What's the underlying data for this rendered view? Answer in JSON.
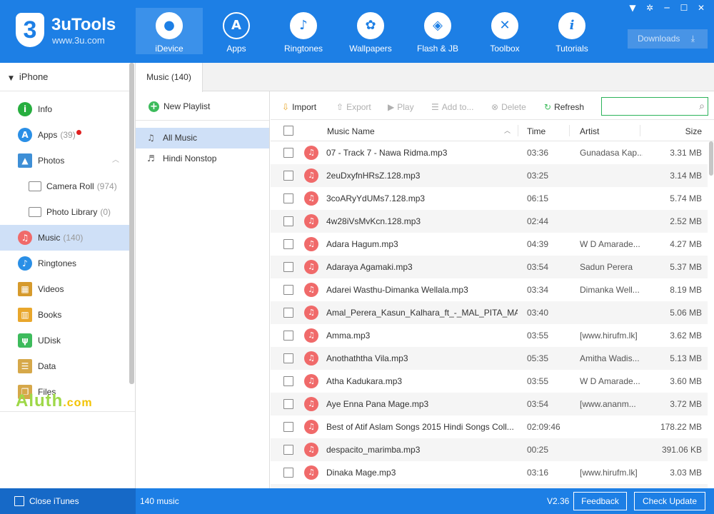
{
  "app": {
    "name": "3uTools",
    "url": "www.3u.com",
    "logo_mark": "3"
  },
  "nav": [
    {
      "label": "iDevice",
      "icon": "apple-icon",
      "glyph": "",
      "active": true
    },
    {
      "label": "Apps",
      "icon": "app-store-icon",
      "glyph": "A"
    },
    {
      "label": "Ringtones",
      "icon": "bell-icon",
      "glyph": "♪"
    },
    {
      "label": "Wallpapers",
      "icon": "flower-icon",
      "glyph": "✿"
    },
    {
      "label": "Flash & JB",
      "icon": "box-icon",
      "glyph": "◈"
    },
    {
      "label": "Toolbox",
      "icon": "tools-icon",
      "glyph": "✕"
    },
    {
      "label": "Tutorials",
      "icon": "info-icon",
      "glyph": "i"
    }
  ],
  "window_controls": [
    "shirt-icon",
    "gear-icon",
    "minimize-icon",
    "maximize-icon",
    "close-icon"
  ],
  "downloads": {
    "label": "Downloads",
    "icon": "download-icon"
  },
  "sidebar": {
    "device": "iPhone",
    "items": [
      {
        "label": "Info",
        "icon": "info-icon",
        "glyph": "i",
        "color": "#27ae3f"
      },
      {
        "label": "Apps",
        "count": "(39)",
        "icon": "app-store-icon",
        "glyph": "A",
        "color": "#2a8fe6",
        "badge_color": "#e02020"
      },
      {
        "label": "Photos",
        "icon": "photos-icon",
        "glyph": "▲",
        "color": "#3e8fd6"
      },
      {
        "label": "Camera Roll",
        "count": "(974)",
        "icon": "folder-icon",
        "sub": true
      },
      {
        "label": "Photo Library",
        "count": "(0)",
        "icon": "folder-icon",
        "sub": true
      },
      {
        "label": "Music",
        "count": "(140)",
        "icon": "music-icon",
        "glyph": "♫",
        "color": "#f06a6a",
        "selected": true
      },
      {
        "label": "Ringtones",
        "icon": "bell-icon",
        "glyph": "♪",
        "color": "#2a8fe6"
      },
      {
        "label": "Videos",
        "icon": "film-icon",
        "glyph": "▦",
        "color": "#d69a2c"
      },
      {
        "label": "Books",
        "icon": "book-icon",
        "glyph": "▥",
        "color": "#e9a72c"
      },
      {
        "label": "UDisk",
        "icon": "usb-icon",
        "glyph": "ψ",
        "color": "#3dbb5c"
      },
      {
        "label": "Data",
        "icon": "data-icon",
        "glyph": "☰",
        "color": "#d6a84a"
      },
      {
        "label": "Files",
        "icon": "files-icon",
        "glyph": "❐",
        "color": "#d6a84a"
      }
    ]
  },
  "watermark": {
    "main": "Aluth",
    "suffix": ".com"
  },
  "tab": {
    "label": "Music (140)"
  },
  "playlists": {
    "new_label": "New Playlist",
    "items": [
      {
        "label": "All Music",
        "icon": "music-list-icon",
        "selected": true
      },
      {
        "label": "Hindi Nonstop",
        "icon": "playlist-icon"
      }
    ]
  },
  "toolbar": {
    "import": "Import",
    "export": "Export",
    "play": "Play",
    "add_to": "Add to...",
    "delete": "Delete",
    "refresh": "Refresh",
    "search_placeholder": ""
  },
  "columns": {
    "name": "Music Name",
    "time": "Time",
    "artist": "Artist",
    "size": "Size"
  },
  "rows": [
    {
      "name": "07 - Track  7 - Nawa Ridma.mp3",
      "time": "03:36",
      "artist": "Gunadasa Kap...",
      "size": "3.31 MB"
    },
    {
      "name": "2euDxyfnHRsZ.128.mp3",
      "time": "03:25",
      "artist": "",
      "size": "3.14 MB"
    },
    {
      "name": "3coARyYdUMs7.128.mp3",
      "time": "06:15",
      "artist": "",
      "size": "5.74 MB"
    },
    {
      "name": "4w28iVsMvKcn.128.mp3",
      "time": "02:44",
      "artist": "",
      "size": "2.52 MB"
    },
    {
      "name": "Adara Hagum.mp3",
      "time": "04:39",
      "artist": "W D Amarade...",
      "size": "4.27 MB"
    },
    {
      "name": "Adaraya Agamaki.mp3",
      "time": "03:54",
      "artist": "Sadun Perera",
      "size": "5.37 MB"
    },
    {
      "name": "Adarei Wasthu-Dimanka Wellala.mp3",
      "time": "03:34",
      "artist": "Dimanka Well...",
      "size": "8.19 MB"
    },
    {
      "name": "Amal_Perera_Kasun_Kalhara_ft_-_MAL_PITA_MA...",
      "time": "03:40",
      "artist": "",
      "size": "5.06 MB"
    },
    {
      "name": "Amma.mp3",
      "time": "03:55",
      "artist": "[www.hirufm.lk]",
      "size": "3.62 MB"
    },
    {
      "name": "Anothaththa Vila.mp3",
      "time": "05:35",
      "artist": "Amitha Wadis...",
      "size": "5.13 MB"
    },
    {
      "name": "Atha Kadukara.mp3",
      "time": "03:55",
      "artist": "W D Amarade...",
      "size": "3.60 MB"
    },
    {
      "name": "Aye Enna Pana Mage.mp3",
      "time": "03:54",
      "artist": "[www.ananm...",
      "size": "3.72 MB"
    },
    {
      "name": "Best of Atif Aslam Songs 2015   Hindi Songs Coll...",
      "time": "02:09:46",
      "artist": "",
      "size": "178.22 MB"
    },
    {
      "name": "despacito_marimba.mp3",
      "time": "00:25",
      "artist": "",
      "size": "391.06 KB"
    },
    {
      "name": "Dinaka Mage.mp3",
      "time": "03:16",
      "artist": "[www.hirufm.lk]",
      "size": "3.03 MB"
    }
  ],
  "status": {
    "close_itunes": "Close iTunes",
    "count": "140 music",
    "version": "V2.36",
    "feedback": "Feedback",
    "check_update": "Check Update"
  },
  "colors": {
    "brand": "#1d7fe5",
    "selection": "#cfe0f7",
    "music_icon": "#f06a6a",
    "search_border": "#2cb35a"
  }
}
